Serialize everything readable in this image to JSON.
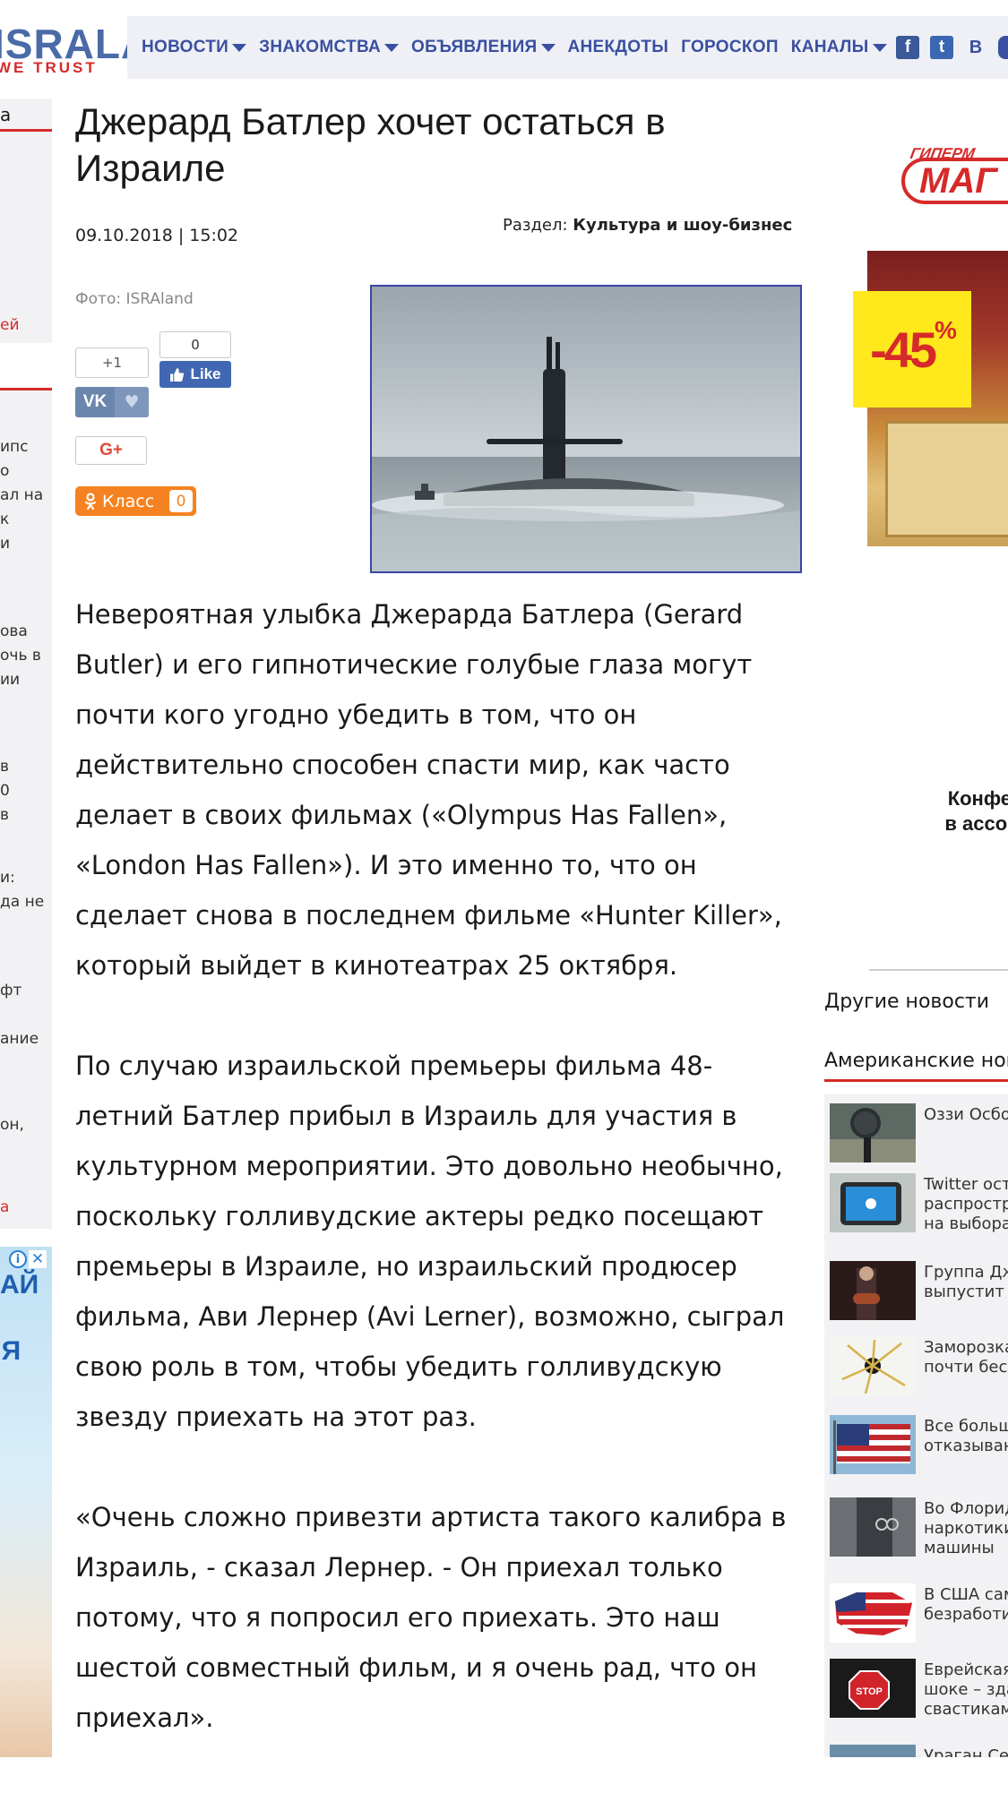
{
  "header": {
    "logo_main": "ISRALAND",
    "logo_sub": "WE TRUST",
    "nav": [
      {
        "label": "НОВОСТИ",
        "dropdown": true
      },
      {
        "label": "ЗНАКОМСТВА",
        "dropdown": true
      },
      {
        "label": "ОБЪЯВЛЕНИЯ",
        "dropdown": true
      },
      {
        "label": "АНЕКДОТЫ",
        "dropdown": false
      },
      {
        "label": "ГОРОСКОП",
        "dropdown": false
      },
      {
        "label": "КАНАЛЫ",
        "dropdown": true
      }
    ],
    "social": {
      "facebook": "f",
      "twitter": "t",
      "vk": "В"
    }
  },
  "left_sidebar": {
    "top_mark": "а",
    "fragments": [
      {
        "text": "ей",
        "red": true
      },
      {
        "text": "ипс"
      },
      {
        "text": "о"
      },
      {
        "text": "ал на"
      },
      {
        "text": "к"
      },
      {
        "text": "и"
      },
      {
        "text": "ова"
      },
      {
        "text": "очь в"
      },
      {
        "text": "ии"
      },
      {
        "text": "в"
      },
      {
        "text": "0"
      },
      {
        "text": "в"
      },
      {
        "text": "и:"
      },
      {
        "text": "да не"
      },
      {
        "text": "фт"
      },
      {
        "text": "ание"
      },
      {
        "text": "он,"
      },
      {
        "text": "а",
        "red": true
      }
    ],
    "ad": {
      "info_icon": "i",
      "close_icon": "✕",
      "line1": "АЙ",
      "line2": "ЯЯ"
    }
  },
  "article": {
    "title": "Джерард Батлер хочет остаться в Израиле",
    "date": "09.10.2018 | 15:02",
    "section_label": "Раздел:",
    "section_value": "Культура и шоу-бизнес",
    "photo_credit": "Фото: ISRAland",
    "share": {
      "plus_one": "+1",
      "fb_count": "0",
      "fb_like": "Like",
      "vk": "VK",
      "gplus": "G+",
      "ok_label": "Класс",
      "ok_count": "0"
    },
    "paragraphs": [
      "Невероятная улыбка Джерарда Батлера (Gerard Butler) и его гипнотические голубые глаза могут почти кого угодно убедить в том, что он действительно способен спасти мир, как часто делает в своих фильмах («Olympus Has Fallen», «London Has Fallen»). И это именно то, что он сделает снова в последнем фильме «Hunter Killer», который выйдет в кинотеатрах 25 октября.",
      "По случаю израильской премьеры фильма 48-летний Батлер прибыл в Израиль для участия в культурном мероприятии. Это довольно необычно, поскольку голливудские актеры редко посещают премьеры в Израиле, но израильский продюсер фильма, Ави Лернер (Avi Lerner), возможно, сыграл свою роль в том, чтобы убедить голливудскую звезду приехать на этот раз.",
      "«Очень сложно привезти артиста такого калибра в Израиль, - сказал Лернер. - Он приехал только потому, что я попросил его приехать. Это наш шестой совместный фильм, и я очень рад, что он приехал»."
    ]
  },
  "right_sidebar": {
    "ad": {
      "hyper": "ГИПЕРМ",
      "brand": "МАГ",
      "sale": "-45",
      "percent": "%",
      "caption_line1": "Конфеты",
      "caption_line2": "в ассорти"
    },
    "other_news": "Другие новости",
    "category": "Американские нов",
    "items": [
      {
        "lines": [
          "Оззи Осбо"
        ]
      },
      {
        "lines": [
          "Twitter оста",
          "распростра",
          "на выбора"
        ]
      },
      {
        "lines": [
          "Группа Дж",
          "выпустит п"
        ]
      },
      {
        "lines": [
          "Заморозка",
          "почти бесс"
        ]
      },
      {
        "lines": [
          "Все больш",
          "отказываю"
        ]
      },
      {
        "lines": [
          "Во Флорид",
          "наркотики",
          "машины"
        ]
      },
      {
        "lines": [
          "В США сам",
          "безработи"
        ]
      },
      {
        "lines": [
          "Еврейская",
          "шоке – зда",
          "свастикам"
        ]
      },
      {
        "lines": [
          "Ураган Сег"
        ]
      }
    ]
  },
  "colors": {
    "nav_blue": "#3a4fa0",
    "accent_red": "#d62a2a",
    "photo_border": "#3c45a6",
    "ok_orange": "#f58220"
  }
}
